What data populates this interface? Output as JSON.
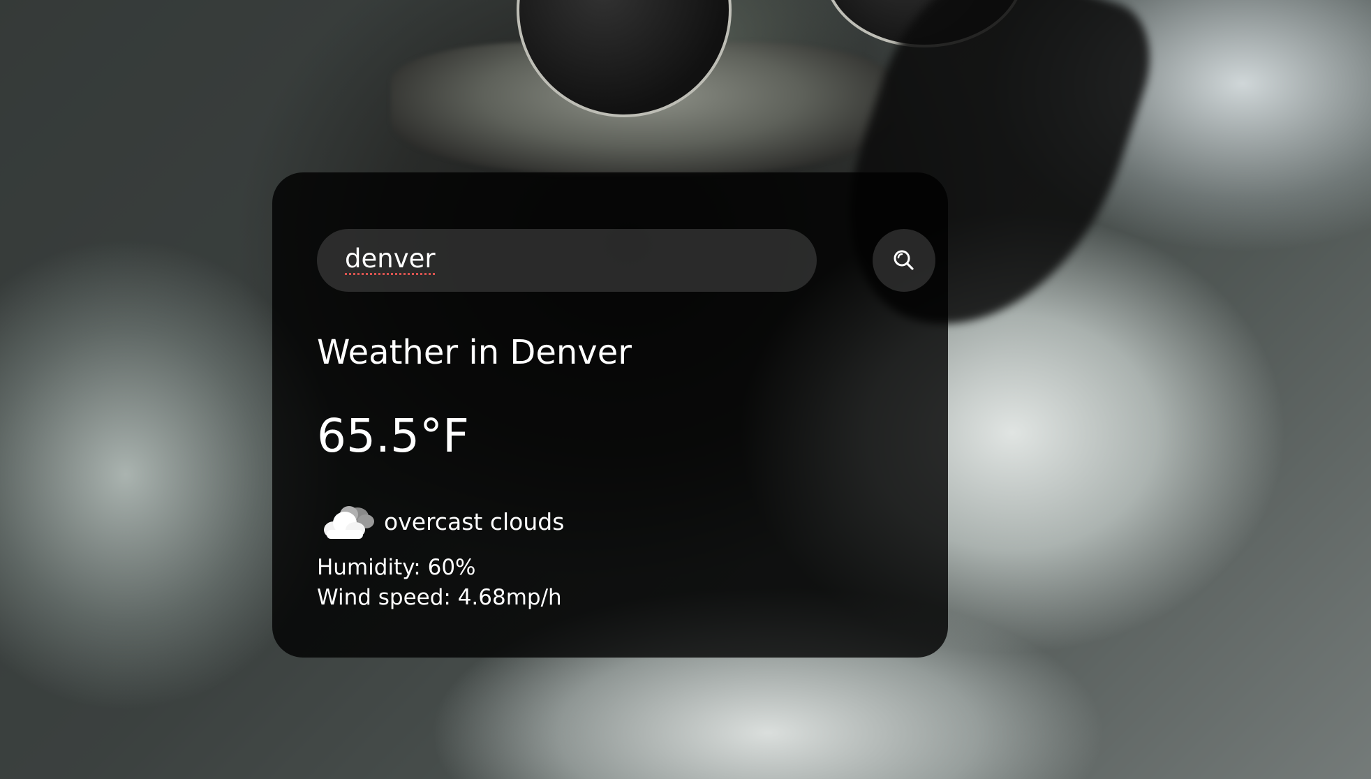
{
  "search": {
    "value": "denver",
    "button_icon": "search-icon"
  },
  "weather": {
    "title": "Weather in Denver",
    "temperature": "65.5°F",
    "condition_icon": "cloud-icon",
    "description": "overcast clouds",
    "humidity": "Humidity: 60%",
    "wind": "Wind speed: 4.68mp/h"
  },
  "colors": {
    "card_background": "#000000",
    "text": "#ffffff",
    "spellcheck_underline": "#d9534f"
  }
}
